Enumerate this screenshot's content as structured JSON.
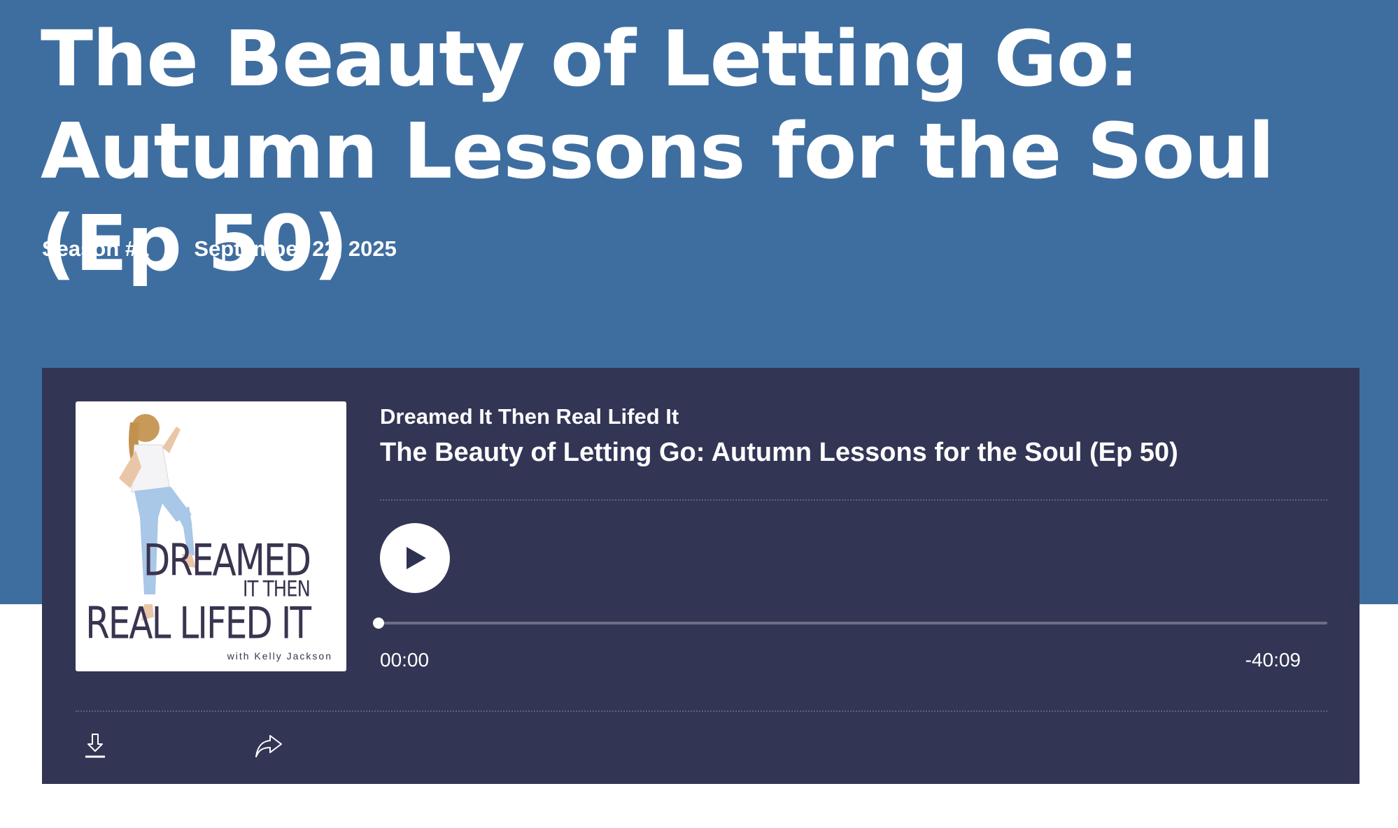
{
  "episode": {
    "title": "The Beauty of Letting Go: Autumn Lessons for the Soul (Ep 50)",
    "season": "Season #1",
    "date": "September 22, 2025"
  },
  "player": {
    "show_name": "Dreamed It Then Real Lifed It",
    "episode_title": "The Beauty of Letting Go: Autumn Lessons for the Soul (Ep 50)",
    "current_time": "00:00",
    "remaining_time": "-40:09",
    "progress": 0.0,
    "play_icon": "play-icon",
    "download_icon": "download-icon",
    "share_icon": "share-icon"
  },
  "cover": {
    "line1": "DREAMED",
    "line2": "IT THEN",
    "line3": "REAL LIFED IT",
    "credit": "with Kelly Jackson"
  },
  "colors": {
    "hero_bg": "#3e6ea0",
    "player_bg": "#333555",
    "text": "#ffffff"
  }
}
